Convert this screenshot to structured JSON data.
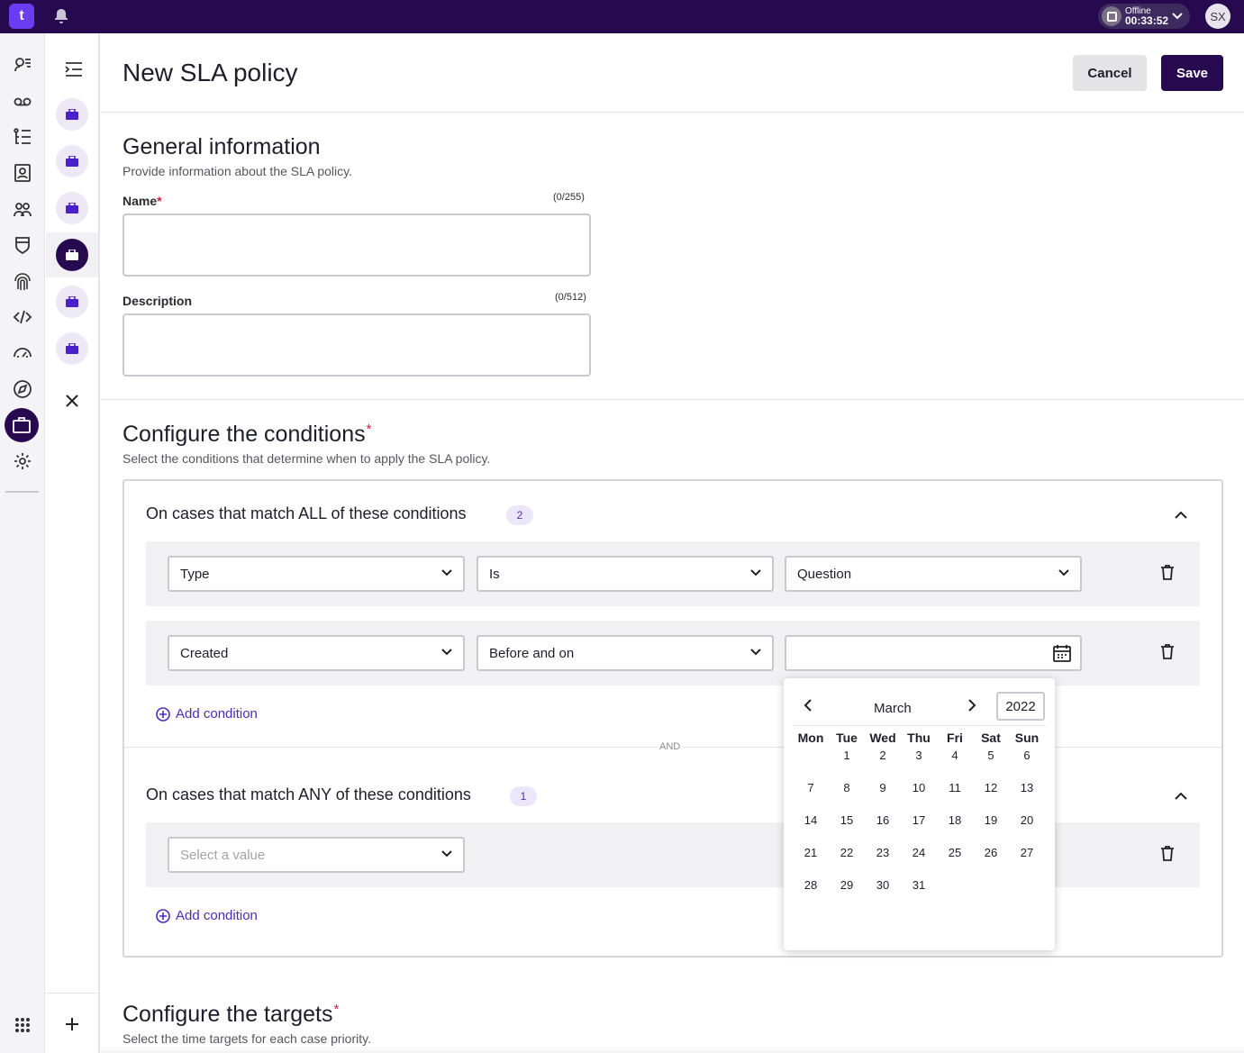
{
  "topbar": {
    "logo_letter": "t",
    "status_label": "Offline",
    "status_time": "00:33:52",
    "avatar_initials": "SX"
  },
  "page": {
    "title": "New SLA policy",
    "cancel_label": "Cancel",
    "save_label": "Save"
  },
  "general": {
    "title": "General information",
    "subtitle": "Provide information about the SLA policy.",
    "name_label": "Name",
    "name_required": "*",
    "name_counter": "(0/255)",
    "name_value": "",
    "description_label": "Description",
    "description_counter": "(0/512)",
    "description_value": ""
  },
  "conditions": {
    "title": "Configure the conditions",
    "required": "*",
    "subtitle": "Select the conditions that determine when to apply the SLA policy.",
    "all_group": {
      "title": "On cases that match ALL of these conditions",
      "count": "2",
      "rows": [
        {
          "field": "Type",
          "operator": "Is",
          "value": "Question"
        },
        {
          "field": "Created",
          "operator": "Before and on",
          "value": ""
        }
      ],
      "add_label": "Add condition"
    },
    "and_label": "AND",
    "any_group": {
      "title": "On cases that match ANY of these conditions",
      "count": "1",
      "rows": [
        {
          "field_placeholder": "Select a value"
        }
      ],
      "add_label": "Add condition"
    }
  },
  "datepicker": {
    "month": "March",
    "year": "2022",
    "weekdays": [
      "Mon",
      "Tue",
      "Wed",
      "Thu",
      "Fri",
      "Sat",
      "Sun"
    ],
    "first_weekday_offset": 1,
    "days": [
      "1",
      "2",
      "3",
      "4",
      "5",
      "6",
      "7",
      "8",
      "9",
      "10",
      "11",
      "12",
      "13",
      "14",
      "15",
      "16",
      "17",
      "18",
      "19",
      "20",
      "21",
      "22",
      "23",
      "24",
      "25",
      "26",
      "27",
      "28",
      "29",
      "30",
      "31"
    ]
  },
  "targets": {
    "title": "Configure the targets",
    "required": "*",
    "subtitle": "Select the time targets for each case priority."
  },
  "colors": {
    "brand": "#26094f",
    "accent": "#4b2bb8",
    "required": "#d0203b"
  },
  "icons": {
    "rail": [
      "contacts-icon",
      "voicemail-icon",
      "list-icon",
      "address-book-icon",
      "users-icon",
      "shield-icon",
      "fingerprint-icon",
      "code-icon",
      "gauge-icon",
      "compass-icon",
      "briefcase-icon",
      "settings-icon",
      "apps-grid-icon"
    ],
    "panel": [
      "menu-collapse-icon",
      "briefcase-icon",
      "close-icon",
      "plus-icon"
    ]
  }
}
